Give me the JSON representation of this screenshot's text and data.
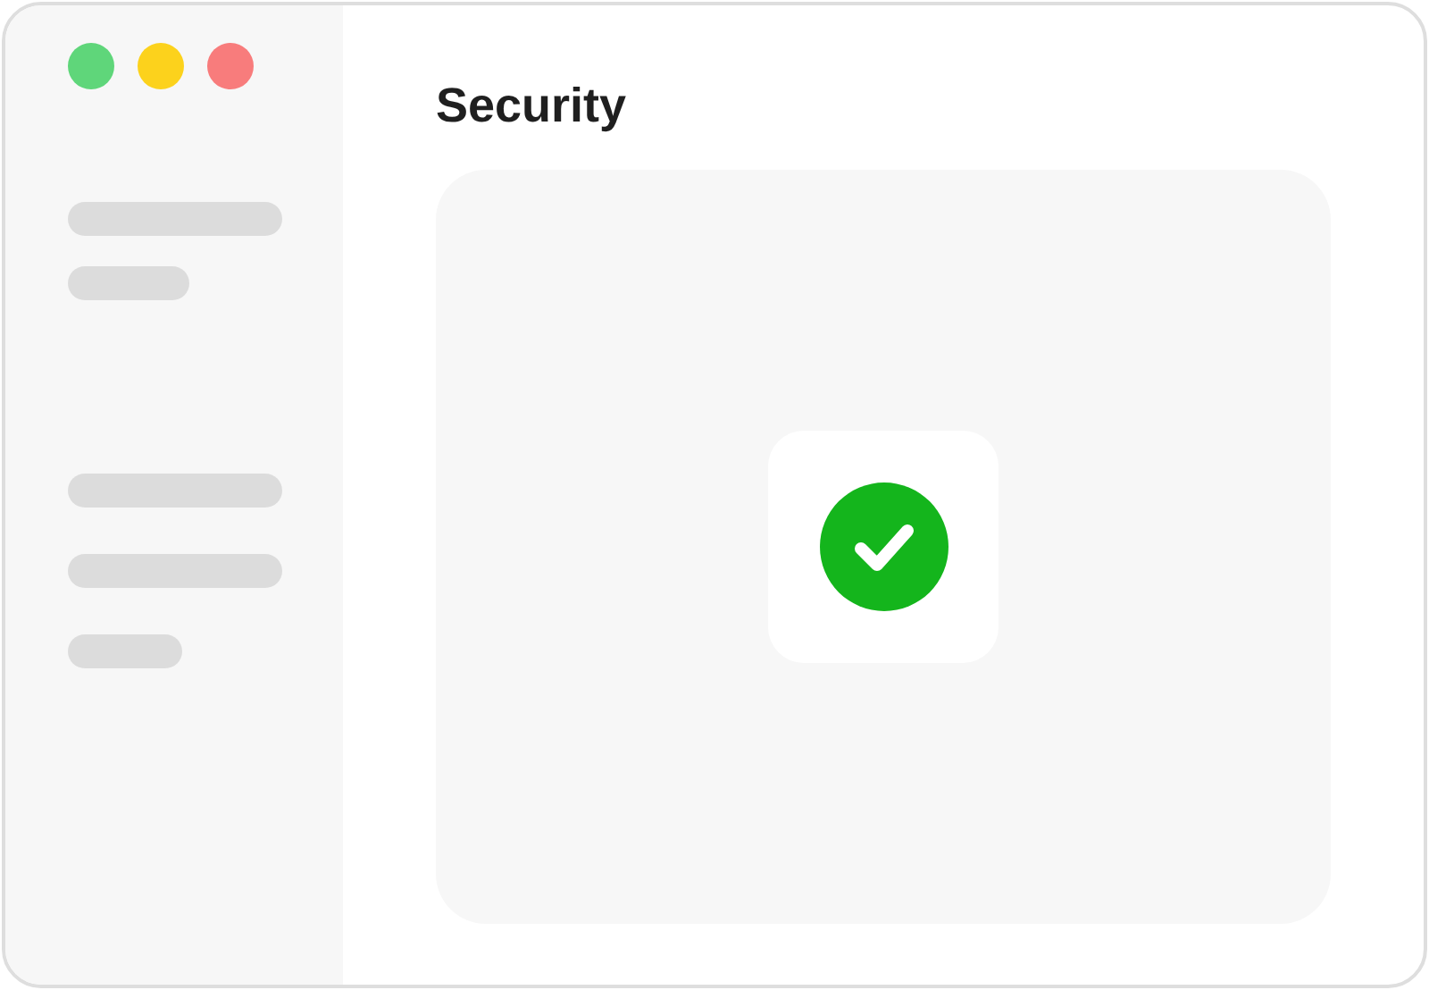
{
  "window": {
    "traffic_lights": [
      {
        "color": "#5fd67a"
      },
      {
        "color": "#fcd21c"
      },
      {
        "color": "#f87c7c"
      }
    ]
  },
  "title": "Security",
  "status": {
    "kind": "success"
  }
}
